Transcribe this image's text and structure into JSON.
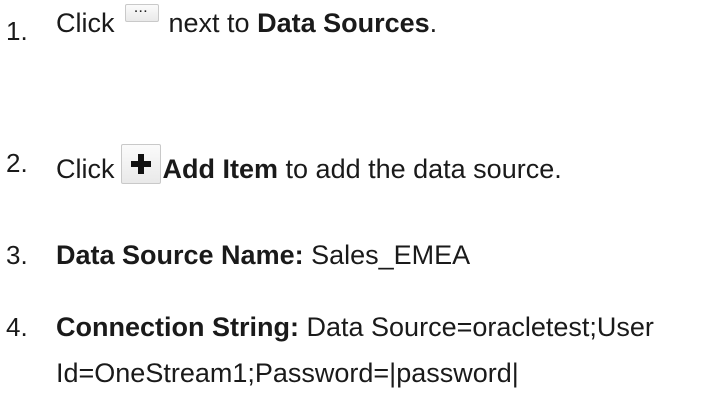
{
  "steps": [
    {
      "number": "1.",
      "before": "Click",
      "icon": "ellipsis-icon",
      "after": "next to",
      "bold": "Data Sources",
      "end": "."
    },
    {
      "number": "2.",
      "before": "Click",
      "icon": "plus-icon",
      "bold": "Add Item",
      "after": "to add the data source."
    },
    {
      "number": "3.",
      "label": "Data Source Name:",
      "value": "Sales_EMEA"
    },
    {
      "number": "4.",
      "label": "Connection String:",
      "value_line1": "Data Source=oracletest;User",
      "value_line2": "Id=OneStream1;Password=|password|"
    }
  ]
}
